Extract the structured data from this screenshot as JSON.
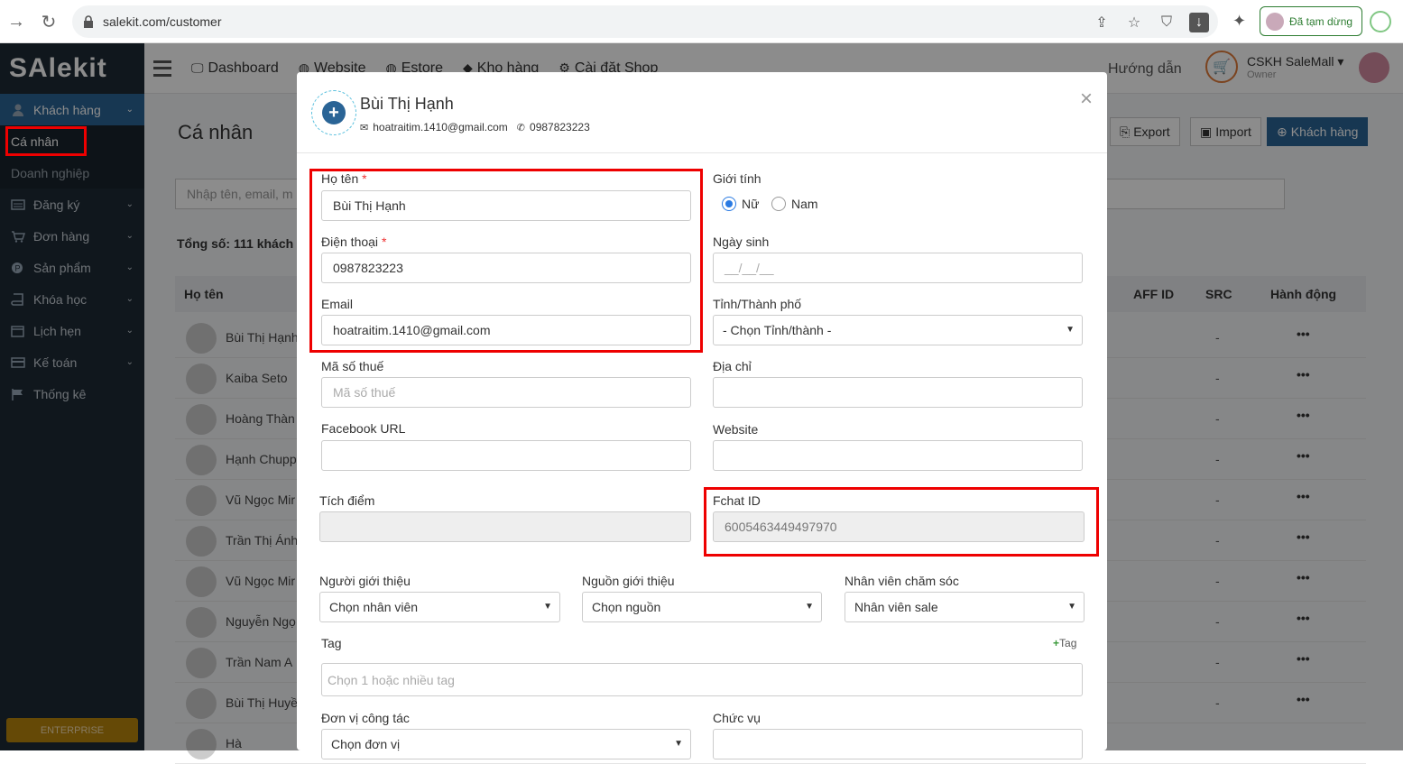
{
  "browser": {
    "url": "salekit.com/customer",
    "paused_label": "Đã tạm dừng"
  },
  "app": {
    "logo": "SAlekit",
    "topnav": [
      {
        "label": "Dashboard",
        "icon": "monitor-icon"
      },
      {
        "label": "Website",
        "icon": "globe-icon"
      },
      {
        "label": "Estore",
        "icon": "globe-icon"
      },
      {
        "label": "Kho hàng",
        "icon": "layers-icon"
      },
      {
        "label": "Cài đặt Shop",
        "icon": "gear-icon"
      }
    ],
    "guide": "Hướng dẫn",
    "user_name": "CSKH SaleMall",
    "user_role": "Owner"
  },
  "sidebar": {
    "items": [
      {
        "label": "Khách hàng",
        "icon": "user-icon"
      },
      {
        "label": "Đăng ký",
        "icon": "card-icon"
      },
      {
        "label": "Đơn hàng",
        "icon": "cart-icon"
      },
      {
        "label": "Sản phẩm",
        "icon": "product-icon"
      },
      {
        "label": "Khóa học",
        "icon": "book-icon"
      },
      {
        "label": "Lịch hẹn",
        "icon": "calendar-icon"
      },
      {
        "label": "Kế toán",
        "icon": "credit-card-icon"
      },
      {
        "label": "Thống kê",
        "icon": "flag-icon"
      }
    ],
    "sub_items": [
      "Cá nhân",
      "Doanh nghiệp"
    ],
    "badge": "ENTERPRISE"
  },
  "main": {
    "title": "Cá nhân",
    "buttons": {
      "export": "Export",
      "import": "Import",
      "add": "Khách hàng"
    },
    "search_placeholder": "Nhập tên, email, m",
    "total": "Tổng số: 111 khách h",
    "columns": {
      "name": "Họ tên",
      "aff": "AFF ID",
      "src": "SRC",
      "action": "Hành động"
    },
    "rows": [
      {
        "name": "Bùi Thị Hạnh",
        "src": "-",
        "action": "•••"
      },
      {
        "name": "Kaiba Seto",
        "src": "-",
        "action": "•••"
      },
      {
        "name": "Hoàng Thàn",
        "src": "-",
        "action": "•••"
      },
      {
        "name": "Hạnh Chupp",
        "src": "-",
        "action": "•••"
      },
      {
        "name": "Vũ Ngọc Mir",
        "src": "-",
        "action": "•••"
      },
      {
        "name": "Trần Thị Ánh",
        "src": "-",
        "action": "•••"
      },
      {
        "name": "Vũ Ngọc Mir",
        "src": "-",
        "action": "•••"
      },
      {
        "name": "Nguyễn Ngọ",
        "src": "-",
        "action": "•••"
      },
      {
        "name": "Trần Nam A",
        "src": "-",
        "action": "•••"
      },
      {
        "name": "Bùi Thị Huyề",
        "src": "-",
        "action": "•••"
      },
      {
        "name": "Hà",
        "src": "",
        "action": ""
      }
    ]
  },
  "modal": {
    "name": "Bùi Thị Hạnh",
    "email": "hoatraitim.1410@gmail.com",
    "phone": "0987823223",
    "close": "×",
    "fields": {
      "fullname_label": "Họ tên",
      "fullname_value": "Bùi Thị Hạnh",
      "phone_label": "Điện thoại",
      "phone_value": "0987823223",
      "email_label": "Email",
      "email_value": "hoatraitim.1410@gmail.com",
      "tax_label": "Mã số thuế",
      "tax_placeholder": "Mã số thuế",
      "facebook_label": "Facebook URL",
      "gender_label": "Giới tính",
      "gender_female": "Nữ",
      "gender_male": "Nam",
      "birthday_label": "Ngày sinh",
      "birthday_placeholder": "__/__/__",
      "city_label": "Tỉnh/Thành phố",
      "city_value": "- Chọn Tỉnh/thành -",
      "address_label": "Địa chỉ",
      "website_label": "Website",
      "points_label": "Tích điểm",
      "fchat_label": "Fchat ID",
      "fchat_value": "6005463449497970",
      "referrer_label": "Người giới thiệu",
      "referrer_value": "Chọn nhân viên",
      "source_label": "Nguồn giới thiệu",
      "source_value": "Chọn nguồn",
      "staff_label": "Nhân viên chăm sóc",
      "staff_value": "Nhân viên sale",
      "tag_label": "Tag",
      "tag_add": "Tag",
      "tag_placeholder": "Chọn 1 hoặc nhiều tag",
      "org_label": "Đơn vị công tác",
      "org_value": "Chọn đơn vị",
      "position_label": "Chức vụ"
    }
  }
}
